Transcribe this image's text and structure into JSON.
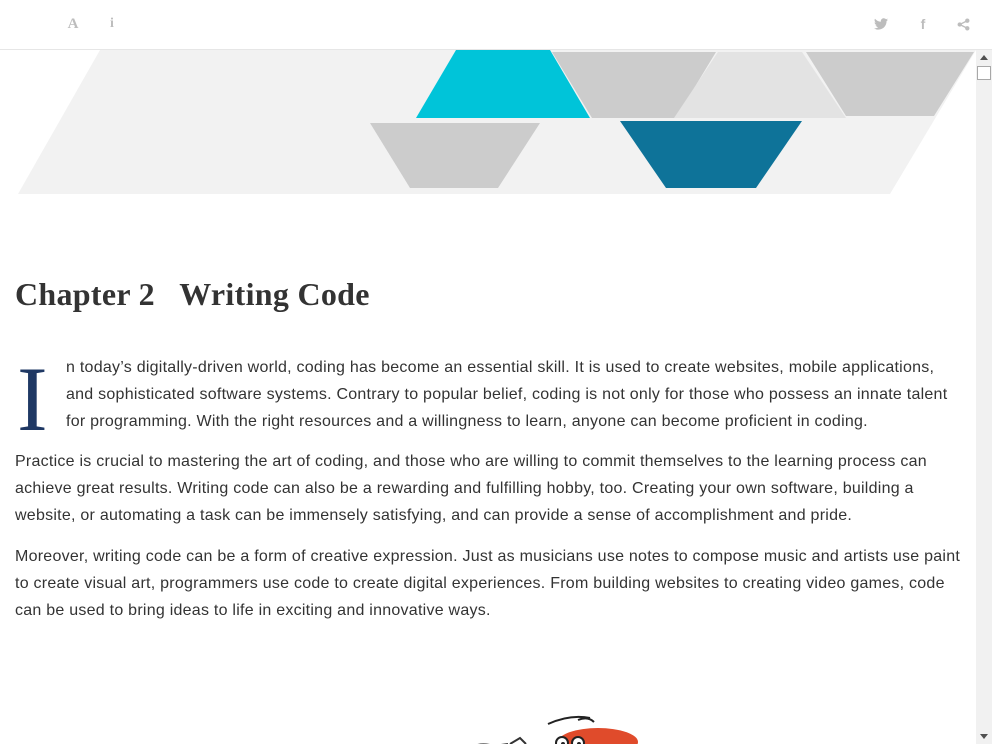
{
  "toolbar": {
    "font_icon_glyph": "A",
    "info_icon_glyph": "i",
    "facebook_icon_glyph": "f"
  },
  "colors": {
    "accent_cyan": "#00c4d9",
    "accent_teal": "#0e7399",
    "gray_shape": "#cccccc",
    "banner_bg": "#f2f2f2",
    "dropcap": "#1f3864"
  },
  "chapter": {
    "title": "Chapter 2   Writing Code",
    "dropcap": "I",
    "paragraphs": [
      "n today’s digitally-driven world, coding has become an essential skill. It is used to create websites, mobile applications, and sophisticated software systems. Contrary to popular belief, coding is not only for those who possess an innate talent for programming. With the right resources and a willingness to learn, anyone can become proficient in coding.",
      "Practice is crucial to mastering the art of coding, and those who are willing to commit themselves to the learning process can achieve great results. Writing code can also be a rewarding and fulfilling hobby, too. Creating your own software, building a website, or automating a task can be immensely satisfying, and can provide a sense of accomplishment and pride.",
      "Moreover, writing code can be a form of creative expression. Just as musicians use notes to compose music and artists use paint to create visual art, programmers use code to create digital experiences. From building websites to creating video games, code can be used to bring ideas to life in exciting and innovative ways."
    ]
  }
}
